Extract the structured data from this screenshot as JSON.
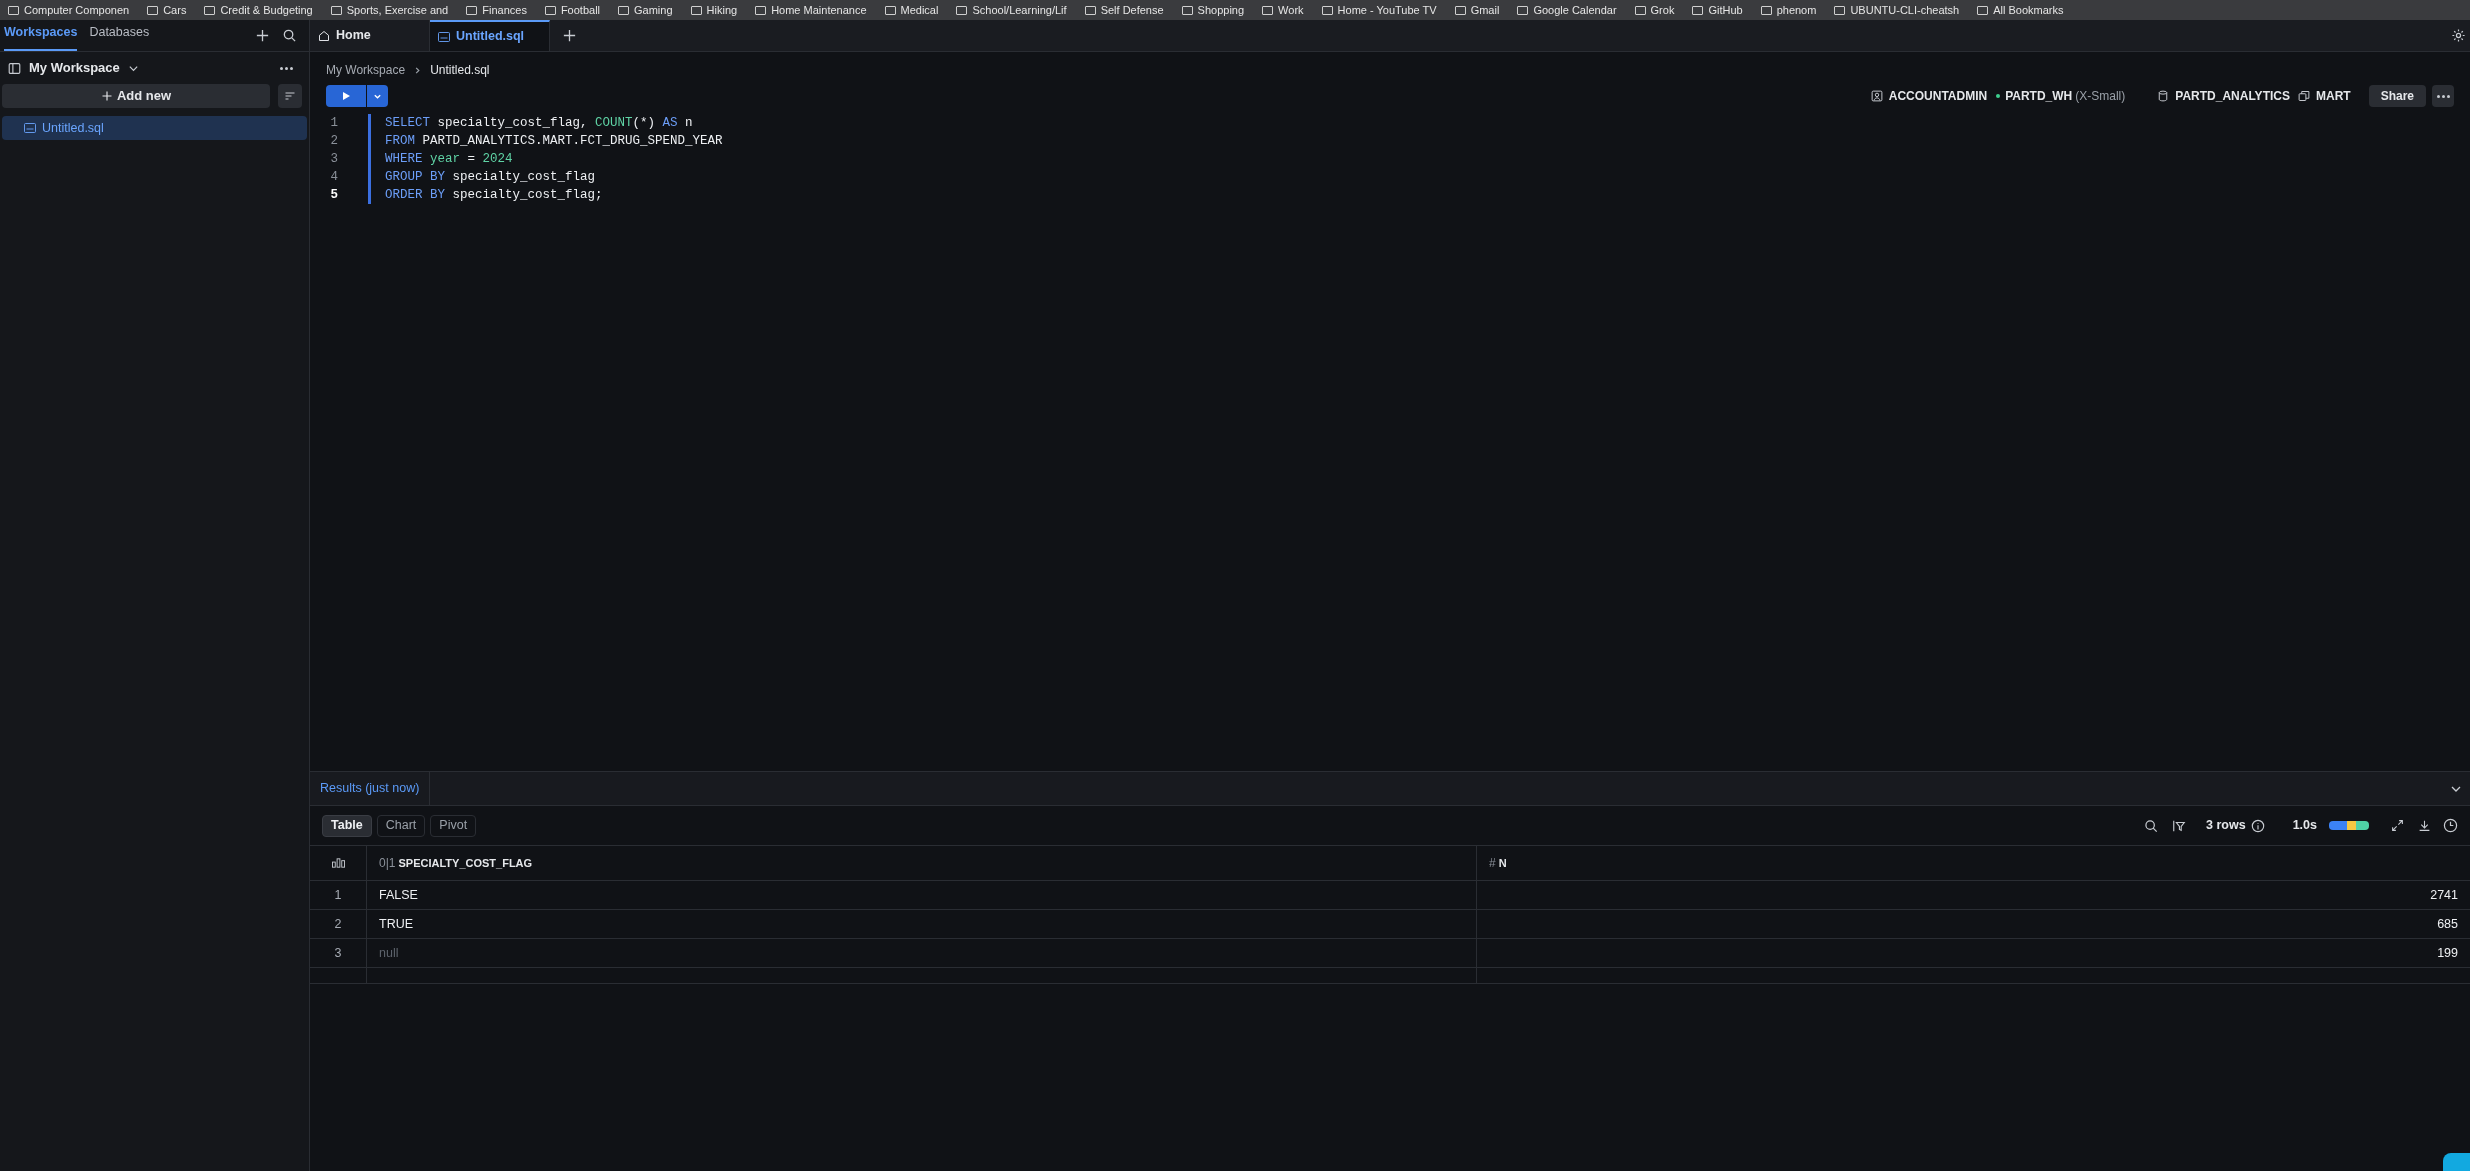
{
  "bookmarks": [
    "Computer Componen",
    "Cars",
    "Credit & Budgeting",
    "Sports, Exercise and",
    "Finances",
    "Football",
    "Gaming",
    "Hiking",
    "Home Maintenance",
    "Medical",
    "School/Learning/Lif",
    "Self Defense",
    "Shopping",
    "Work",
    "Home - YouTube TV",
    "Gmail",
    "Google Calendar",
    "Grok",
    "GitHub",
    "phenom",
    "UBUNTU-CLI-cheatsh",
    "All Bookmarks"
  ],
  "sidebar": {
    "tabs": [
      {
        "label": "Workspaces",
        "selected": true
      },
      {
        "label": "Databases",
        "selected": false
      }
    ],
    "workspace": "My Workspace",
    "add_button": "Add new",
    "files": [
      {
        "name": "Untitled.sql",
        "selected": true
      }
    ]
  },
  "editor_tabs": [
    {
      "label": "Home",
      "kind": "home",
      "selected": false
    },
    {
      "label": "Untitled.sql",
      "kind": "sql",
      "selected": true
    }
  ],
  "breadcrumb": [
    "My Workspace",
    "Untitled.sql"
  ],
  "context": {
    "role": "ACCOUNTADMIN",
    "warehouse": "PARTD_WH",
    "warehouse_size": "(X-Small)",
    "database": "PARTD_ANALYTICS",
    "schema": "MART",
    "share": "Share"
  },
  "code": [
    {
      "number": "1",
      "current": false,
      "tokens": [
        {
          "text": "SELECT",
          "kind": "keyword"
        },
        {
          "text": " specialty_cost_flag, ",
          "kind": "ident"
        },
        {
          "text": "COUNT",
          "kind": "func"
        },
        {
          "text": "(*) ",
          "kind": "ident"
        },
        {
          "text": "AS",
          "kind": "keyword"
        },
        {
          "text": " n",
          "kind": "ident"
        }
      ]
    },
    {
      "number": "2",
      "current": false,
      "tokens": [
        {
          "text": "FROM",
          "kind": "keyword"
        },
        {
          "text": " PARTD_ANALYTICS.MART.FCT_DRUG_SPEND_YEAR",
          "kind": "ident"
        }
      ]
    },
    {
      "number": "3",
      "current": false,
      "tokens": [
        {
          "text": "WHERE",
          "kind": "keyword"
        },
        {
          "text": " year",
          "kind": "func"
        },
        {
          "text": " = ",
          "kind": "ident"
        },
        {
          "text": "2024",
          "kind": "number"
        }
      ]
    },
    {
      "number": "4",
      "current": false,
      "tokens": [
        {
          "text": "GROUP BY",
          "kind": "keyword"
        },
        {
          "text": " specialty_cost_flag",
          "kind": "ident"
        }
      ]
    },
    {
      "number": "5",
      "current": true,
      "tokens": [
        {
          "text": "ORDER BY",
          "kind": "keyword"
        },
        {
          "text": " specialty_cost_flag;",
          "kind": "ident"
        }
      ]
    }
  ],
  "results": {
    "title": "Results (just now)",
    "views": [
      {
        "label": "Table",
        "selected": true
      },
      {
        "label": "Chart",
        "selected": false
      },
      {
        "label": "Pivot",
        "selected": false
      }
    ],
    "row_count": "3 rows",
    "duration": "1.0s",
    "columns": [
      {
        "type": "0|1",
        "name": "SPECIALTY_COST_FLAG",
        "kind": "text"
      },
      {
        "type": "#",
        "name": "N",
        "kind": "number"
      }
    ],
    "rows": [
      {
        "index": "1",
        "cells": [
          {
            "text": "FALSE",
            "null": false
          },
          {
            "text": "2741",
            "null": false
          }
        ]
      },
      {
        "index": "2",
        "cells": [
          {
            "text": "TRUE",
            "null": false
          },
          {
            "text": "685",
            "null": false
          }
        ]
      },
      {
        "index": "3",
        "cells": [
          {
            "text": "null",
            "null": true
          },
          {
            "text": "199",
            "null": false
          }
        ]
      }
    ]
  }
}
